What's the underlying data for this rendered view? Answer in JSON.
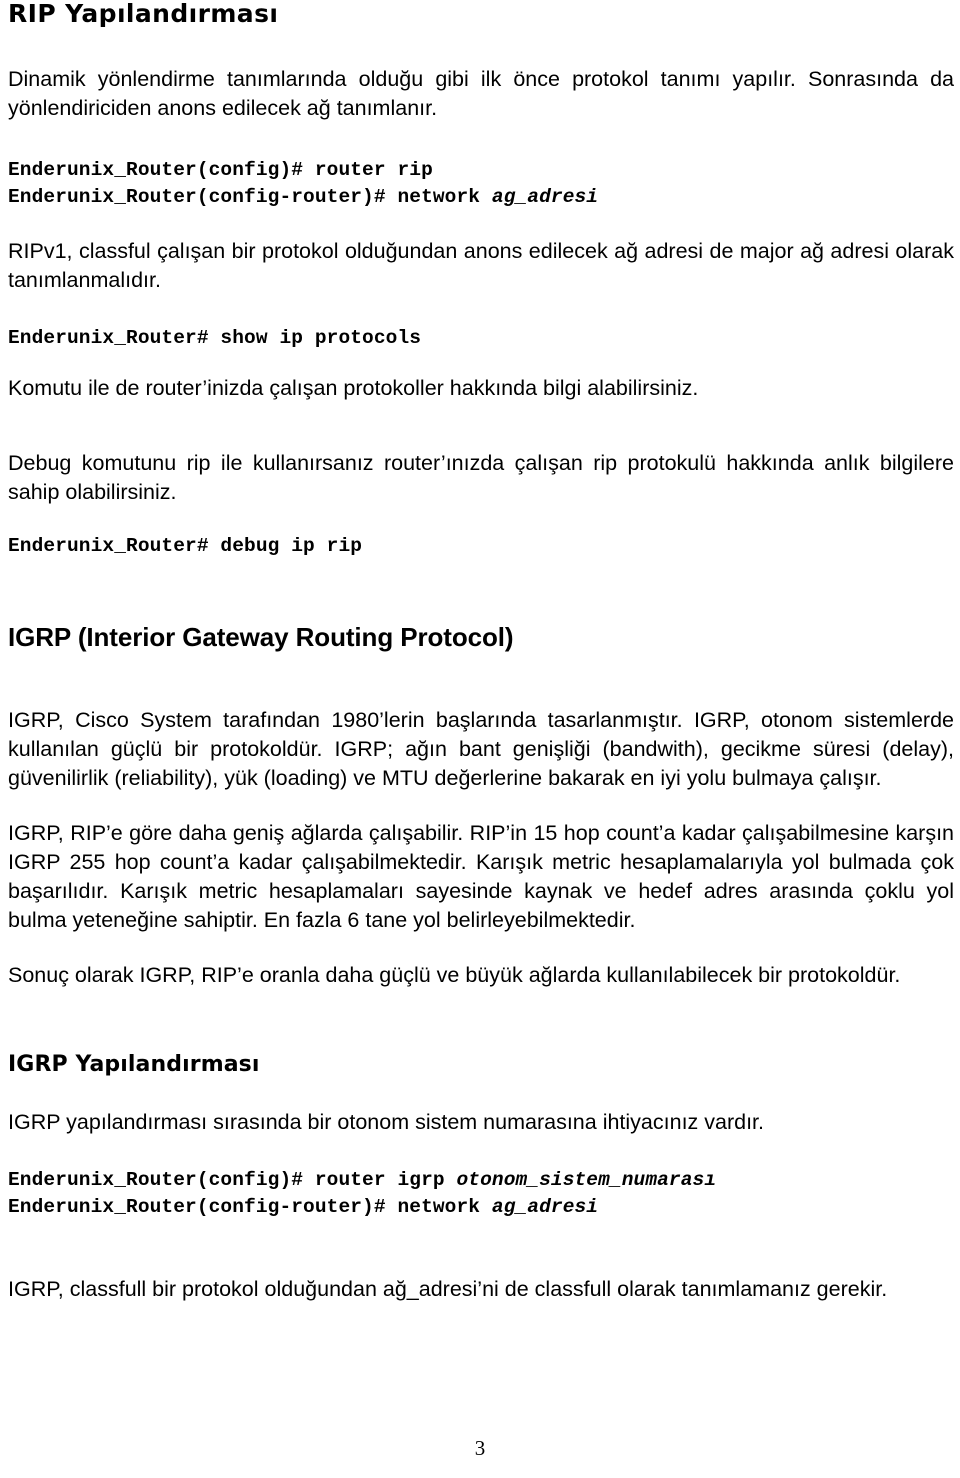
{
  "document": {
    "language": "tr",
    "page_number": "3",
    "text_color": "#000000",
    "background_color": "#ffffff"
  },
  "headings": {
    "rip_config": "RIP Yapılandırması",
    "igrp_section": "IGRP (Interior Gateway Routing Protocol)",
    "igrp_config": "IGRP Yapılandırması"
  },
  "paragraphs": {
    "rip_intro": "Dinamik yönlendirme tanımlarında olduğu gibi ilk önce protokol tanımı yapılır. Sonrasında da yönlendiriciden anons edilecek ağ tanımlanır.",
    "ripv1_note": "RIPv1, classful çalışan bir protokol olduğundan anons edilecek ağ adresi de major ağ adresi olarak tanımlanmalıdır.",
    "show_ip_protocols_note": "Komutu ile de router’inizda çalışan protokoller hakkında bilgi alabilirsiniz.",
    "debug_note": "Debug komutunu rip ile kullanırsanız router’ınızda çalışan rip protokulü hakkında anlık bilgilere sahip olabilirsiniz.",
    "igrp_history": "IGRP, Cisco System tarafından 1980’lerin başlarında tasarlanmıştır. IGRP, otonom sistemlerde kullanılan güçlü bir protokoldür. IGRP; ağın bant genişliği (bandwith), gecikme süresi (delay), güvenilirlik (reliability), yük (loading) ve MTU değerlerine bakarak en iyi yolu bulmaya çalışır.",
    "igrp_comparison": "IGRP, RIP’e göre daha geniş ağlarda çalışabilir. RIP’in 15 hop count’a kadar çalışabilmesine karşın IGRP 255 hop count’a kadar çalışabilmektedir. Karışık metric hesaplamalarıyla yol bulmada çok başarılıdır. Karışık metric hesaplamaları sayesinde kaynak ve hedef adres arasında çoklu yol bulma yeteneğine sahiptir. En fazla 6 tane yol belirleyebilmektedir.",
    "igrp_conclusion": "Sonuç olarak IGRP, RIP’e oranla daha güçlü ve büyük ağlarda kullanılabilecek bir protokoldür.",
    "igrp_as_note": "IGRP yapılandırması sırasında bir otonom sistem numarasına ihtiyacınız vardır.",
    "igrp_classfull_note": "IGRP, classfull bir protokol olduğundan ağ_adresi’ni de classfull olarak tanımlamanız gerekir."
  },
  "commands": {
    "rip_config_block": {
      "line1_prompt": "Enderunix_Router(config)# router rip",
      "line2_prompt": "Enderunix_Router(config-router)# network ",
      "line2_arg": "ag_adresi"
    },
    "show_ip_protocols": "Enderunix_Router# show ip protocols",
    "debug_ip_rip": "Enderunix_Router# debug ip rip",
    "igrp_config_block": {
      "line1_prompt": "Enderunix_Router(config)# router igrp ",
      "line1_arg": "otonom_sistem_numarası",
      "line2_prompt": "Enderunix_Router(config-router)# network ",
      "line2_arg": "ag_adresi"
    }
  }
}
